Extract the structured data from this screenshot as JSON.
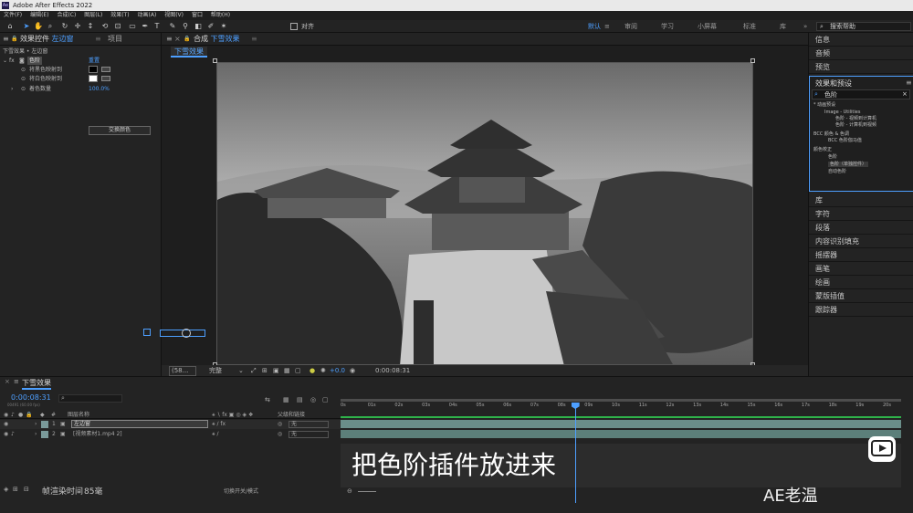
{
  "app": {
    "logo": "Ae",
    "title": "Adobe After Effects 2022"
  },
  "menu": [
    "文件(F)",
    "编辑(E)",
    "合成(C)",
    "图层(L)",
    "效果(T)",
    "动画(A)",
    "视图(V)",
    "窗口",
    "帮助(H)"
  ],
  "toolbar": {
    "align_label": "对齐",
    "workspaces": [
      "默认",
      "≡",
      "审阅",
      "学习",
      "小屏幕",
      "标准",
      "库",
      "»"
    ],
    "active_workspace": "默认",
    "search_help": "搜索帮助"
  },
  "left_panel": {
    "tab_effects": "效果控件",
    "tab_effects_layer": "左边窗",
    "tab_project": "项目",
    "breadcrumb": "下雪效果 • 左边窗",
    "effect_name": "色阶",
    "reset": "重置",
    "props": [
      {
        "label": "将黑色映射到"
      },
      {
        "label": "将白色映射到"
      },
      {
        "label": "着色数量",
        "value": "100.0%"
      }
    ],
    "swap_button": "交换颜色"
  },
  "comp_panel": {
    "title": "合成",
    "comp_name": "下雪效果",
    "sub_tab": "下雪效果",
    "footer": {
      "zoom": "(58...",
      "quality": "完整",
      "exposure": "+0.0",
      "timecode": "0:00:08:31"
    }
  },
  "right_panel": {
    "top_items": [
      "信息",
      "音频",
      "预览"
    ],
    "effects_title": "效果和预设",
    "search_value": "色阶",
    "tree": [
      "* 动画预设",
      "Image - Utilities",
      "色阶 - 视频到计算机",
      "色阶 - 计算机到视频",
      "BCC 颜色 & 色调",
      "BCC 色阶伽马值",
      "颜色校正",
      "色阶",
      "色阶（单独控件）",
      "自动色阶"
    ],
    "bottom_items": [
      "库",
      "字符",
      "段落",
      "内容识别填充",
      "摇摆器",
      "画笔",
      "绘画",
      "蒙版插值",
      "跟踪器"
    ]
  },
  "timeline": {
    "tab": "下雪效果",
    "current_time": "0:00:08:31",
    "frame_info": "00491 (60.00 fps)",
    "col_layer_name": "图层名称",
    "col_parent": "父级和链接",
    "layers": [
      {
        "num": "1",
        "name": "左边窗",
        "parent": "无"
      },
      {
        "num": "2",
        "name": "[视频素材1.mp4 2]",
        "parent": "无"
      }
    ],
    "ruler": [
      "0s",
      "01s",
      "02s",
      "03s",
      "04s",
      "05s",
      "06s",
      "07s",
      "08s",
      "09s",
      "10s",
      "11s",
      "12s",
      "13s",
      "14s",
      "15s",
      "16s",
      "17s",
      "18s",
      "19s",
      "20s"
    ],
    "render_time_label": "帧渲染时间",
    "render_time_value": "85毫",
    "toggle_label": "切换开关/模式",
    "playhead_fraction": 0.418
  },
  "overlay": {
    "subtitle": "把色阶插件放进来",
    "watermark": "AE老温"
  },
  "colors": {
    "accent": "#4d9fff",
    "track": "#5c7f7a"
  }
}
